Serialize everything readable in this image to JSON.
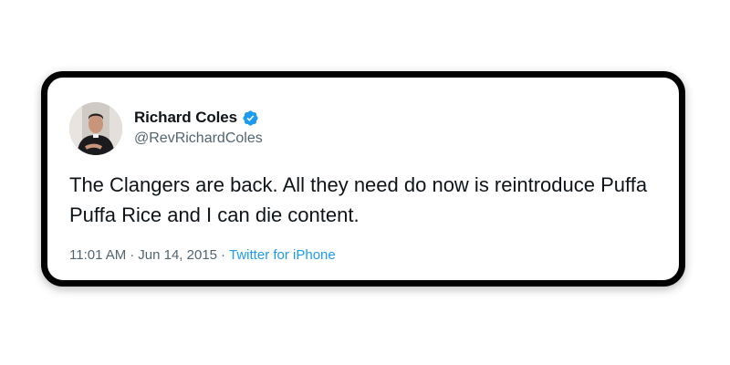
{
  "tweet": {
    "author": {
      "display_name": "Richard Coles",
      "handle": "@RevRichardColes",
      "verified": true,
      "avatar_icon": "priest-portrait-avatar"
    },
    "text": "The Clangers are back. All they need do now is reintroduce Puffa Puffa Rice and I can die content.",
    "time": "11:01 AM",
    "separator": "·",
    "date": "Jun 14, 2015",
    "source": "Twitter for iPhone"
  },
  "colors": {
    "card_border": "#000000",
    "text_primary": "#0f1419",
    "text_secondary": "#536471",
    "accent": "#1d9bf0"
  }
}
